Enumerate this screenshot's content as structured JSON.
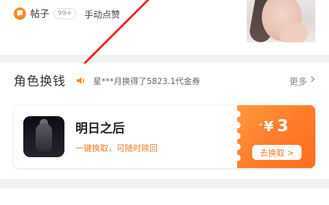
{
  "post_row": {
    "label": "帖子",
    "badge": "99+",
    "description": "手动点赞"
  },
  "role_exchange": {
    "title": "角色换钱",
    "ticker": "星***月换得了5823.1代金券",
    "more_label": "更多"
  },
  "role_card": {
    "title": "明日之后",
    "subtitle": "一键换取，可随时赎回",
    "coupon": {
      "currency_symbol": "¥",
      "amount": "3",
      "button_label": "去换取 >"
    }
  },
  "icons": {
    "post": "chat-bubble-icon",
    "speaker": "speaker-icon",
    "more": "chevron-right-icon"
  },
  "colors": {
    "accent_orange": "#ff7a2a",
    "orange_text": "#f07b2a",
    "pointer_red": "#e81e1e"
  }
}
